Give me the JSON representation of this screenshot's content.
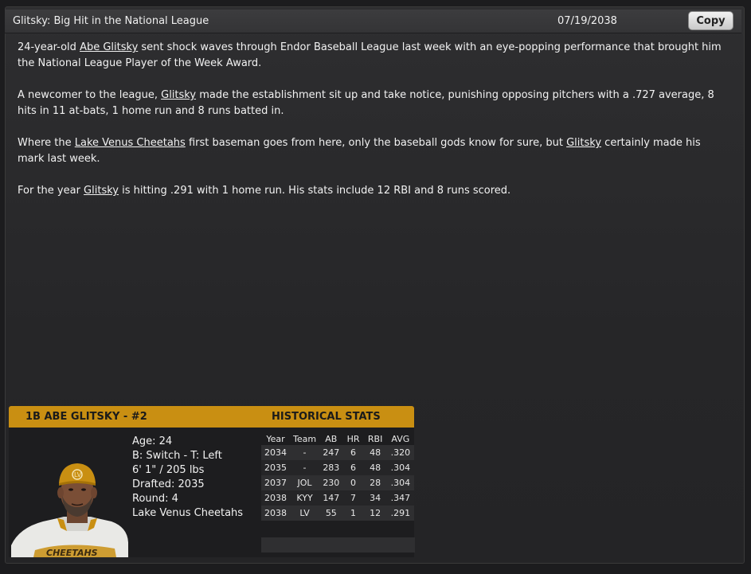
{
  "header": {
    "title": "Glitsky: Big Hit in the National League",
    "date": "07/19/2038",
    "copy_label": "Copy"
  },
  "article": {
    "p1": {
      "pre": "24-year-old ",
      "link": "Abe Glitsky",
      "post": " sent shock waves through Endor Baseball League last week with an eye-popping performance that brought him the National League Player of the Week Award."
    },
    "p2": {
      "pre": "A newcomer to the league, ",
      "link": "Glitsky",
      "post": " made the establishment sit up and take notice, punishing opposing pitchers with a .727 average, 8 hits in 11 at-bats, 1 home run and 8 runs batted in."
    },
    "p3": {
      "pre": "Where the ",
      "link1": "Lake Venus Cheetahs",
      "mid": " first baseman goes from here, only the baseball gods know for sure, but ",
      "link2": "Glitsky",
      "post": " certainly made his mark last week."
    },
    "p4": {
      "pre": "For the year ",
      "link": "Glitsky",
      "post": " is hitting .291 with 1 home run. His stats include 12 RBI and 8 runs scored."
    }
  },
  "card": {
    "name": "1B ABE GLITSKY - #2",
    "historical_label": "HISTORICAL STATS",
    "accent_color": "#c98f12",
    "info": {
      "age": "Age: 24",
      "bats_throws": "B: Switch - T: Left",
      "height_weight": "6' 1\" / 205 lbs",
      "drafted": "Drafted: 2035",
      "round": "Round: 4",
      "team": "Lake Venus Cheetahs"
    },
    "stats": {
      "headers": [
        "Year",
        "Team",
        "AB",
        "HR",
        "RBI",
        "AVG"
      ],
      "rows": [
        [
          "2034",
          "-",
          "247",
          "6",
          "48",
          ".320"
        ],
        [
          "2035",
          "-",
          "283",
          "6",
          "48",
          ".304"
        ],
        [
          "2037",
          "JOL",
          "230",
          "0",
          "28",
          ".304"
        ],
        [
          "2038",
          "KYY",
          "147",
          "7",
          "34",
          ".347"
        ],
        [
          "2038",
          "LV",
          "55",
          "1",
          "12",
          ".291"
        ]
      ]
    }
  }
}
